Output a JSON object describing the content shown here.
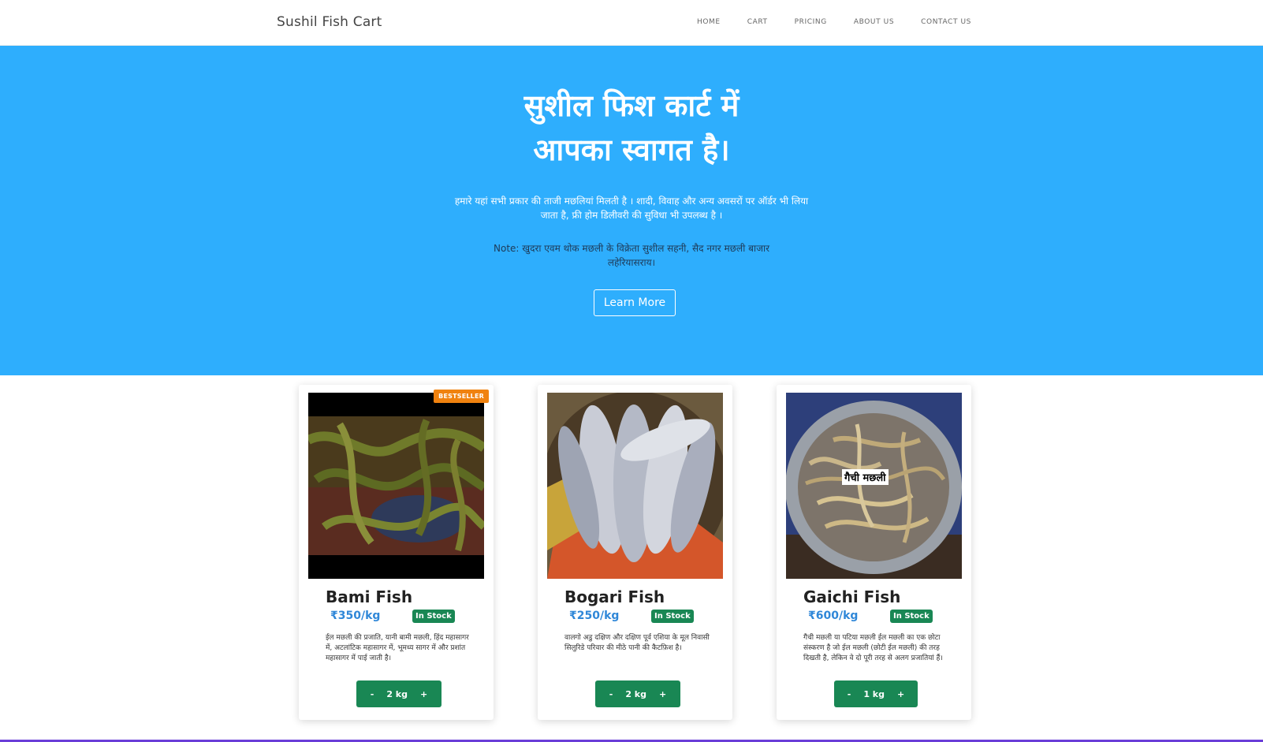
{
  "navbar": {
    "brand": "Sushil Fish Cart",
    "links": [
      "HOME",
      "CART",
      "PRICING",
      "ABOUT US",
      "CONTACT US"
    ]
  },
  "hero": {
    "title_line1": "सुशील फिश कार्ट में",
    "title_line2": "आपका स्वागत है।",
    "text": "हमारे यहां सभी प्रकार की ताजी मछलियां मिलती है । शादी, विवाह और अन्य अवसरों पर ऑर्डर भी लिया जाता है, फ्री होम डिलीवरी की सुविधा भी उपलब्ध है ।",
    "note": "Note: खुदरा एवम थोक मछली के विक्रेता सुशील सहनी, सैद नगर मछली बाजार लहेरियासराय।",
    "button": "Learn More"
  },
  "products": [
    {
      "name": "Bami Fish",
      "price": "₹350/kg",
      "stock": "In Stock",
      "badge": "BESTSELLER",
      "desc": "ईल मछली की प्रजाति, यानी बामी मछली, हिंद महासागर में, अटलांटिक महासागर में, भूमध्य सागर में और प्रशांत महासागर में पाई जाती है।",
      "qty": "2 kg",
      "minus": "-",
      "plus": "+"
    },
    {
      "name": "Bogari Fish",
      "price": "₹250/kg",
      "stock": "In Stock",
      "desc": "वालगो अडु दक्षिण और दक्षिण पूर्व एशिया के मूल निवासी सिलुरिडे परिवार की मीठे पानी की कैटफ़िश है।",
      "qty": "2 kg",
      "minus": "-",
      "plus": "+"
    },
    {
      "name": "Gaichi Fish",
      "price": "₹600/kg",
      "stock": "In Stock",
      "image_label": "गैची मछली",
      "desc": "गैची मछली या पटिया मछली ईल मछली का एक छोटा संस्करण है जो ईल मछली (छोटी ईल मछली) की तरह दिखती है, लेकिन वे दो पूरी तरह से अलग प्रजातियां हैं।",
      "qty": "1 kg",
      "minus": "-",
      "plus": "+"
    }
  ],
  "colors": {
    "hero_bg": "#2eaefd",
    "green": "#198754",
    "price_blue": "#2f87d8",
    "badge_orange": "#f0820f"
  }
}
